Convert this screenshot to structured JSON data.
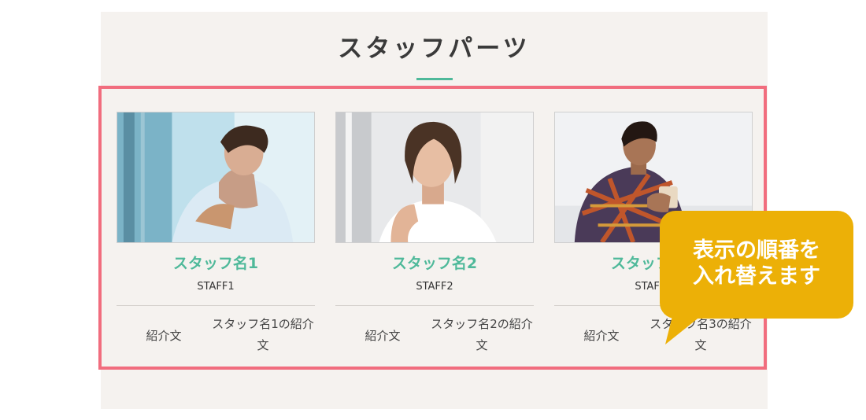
{
  "section": {
    "title": "スタッフパーツ"
  },
  "staff": [
    {
      "name": "スタッフ名1",
      "role": "STAFF1",
      "intro_label": "紹介文",
      "intro_text": "スタッフ名1の紹介文"
    },
    {
      "name": "スタッフ名2",
      "role": "STAFF2",
      "intro_label": "紹介文",
      "intro_text": "スタッフ名2の紹介文"
    },
    {
      "name": "スタッフ名3",
      "role": "STAFF3",
      "intro_label": "紹介文",
      "intro_text": "スタッフ名3の紹介文"
    }
  ],
  "callout": {
    "line1": "表示の順番を",
    "line2": "入れ替えます"
  },
  "colors": {
    "accent": "#4fb99a",
    "highlight": "#f16d7e",
    "callout": "#ecb007",
    "panel": "#f5f2ef"
  }
}
